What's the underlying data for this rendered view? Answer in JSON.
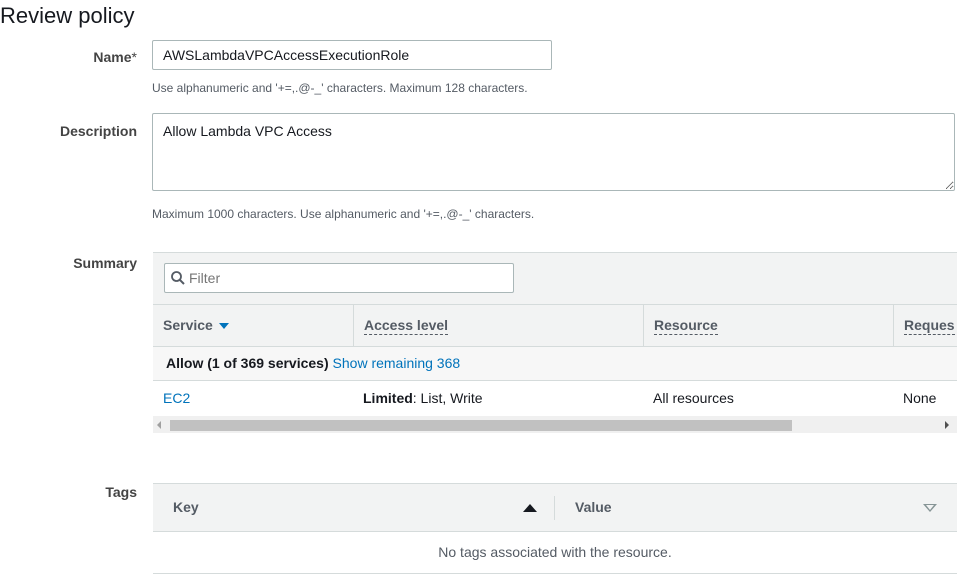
{
  "page": {
    "title": "Review policy"
  },
  "form": {
    "name_label": "Name",
    "name_required_mark": "*",
    "name_value": "AWSLambdaVPCAccessExecutionRole",
    "name_hint": "Use alphanumeric and '+=,.@-_' characters. Maximum 128 characters.",
    "description_label": "Description",
    "description_value": "Allow Lambda VPC Access",
    "description_hint": "Maximum 1000 characters. Use alphanumeric and '+=,.@-_' characters."
  },
  "summary": {
    "label": "Summary",
    "filter_placeholder": "Filter",
    "columns": [
      "Service",
      "Access level",
      "Resource",
      "Request condition"
    ],
    "visible_header_last": "Reques",
    "group_label": "Allow (1 of 369 services)",
    "group_link": "Show remaining 368",
    "rows": [
      {
        "service": "EC2",
        "access_strong": "Limited",
        "access_rest": ": List, Write",
        "resource": "All resources",
        "request": "None"
      }
    ]
  },
  "tags": {
    "label": "Tags",
    "columns": [
      "Key",
      "Value"
    ],
    "empty_message": "No tags associated with the resource."
  },
  "icons": {
    "search": "search-icon",
    "sort_down": "sort-desc-icon",
    "sort_up": "sort-asc-icon",
    "sort_unsorted": "sort-dropdown-icon"
  },
  "colors": {
    "link": "#0073bb",
    "header_bg": "#f2f3f3",
    "border": "#d5dbdb"
  }
}
